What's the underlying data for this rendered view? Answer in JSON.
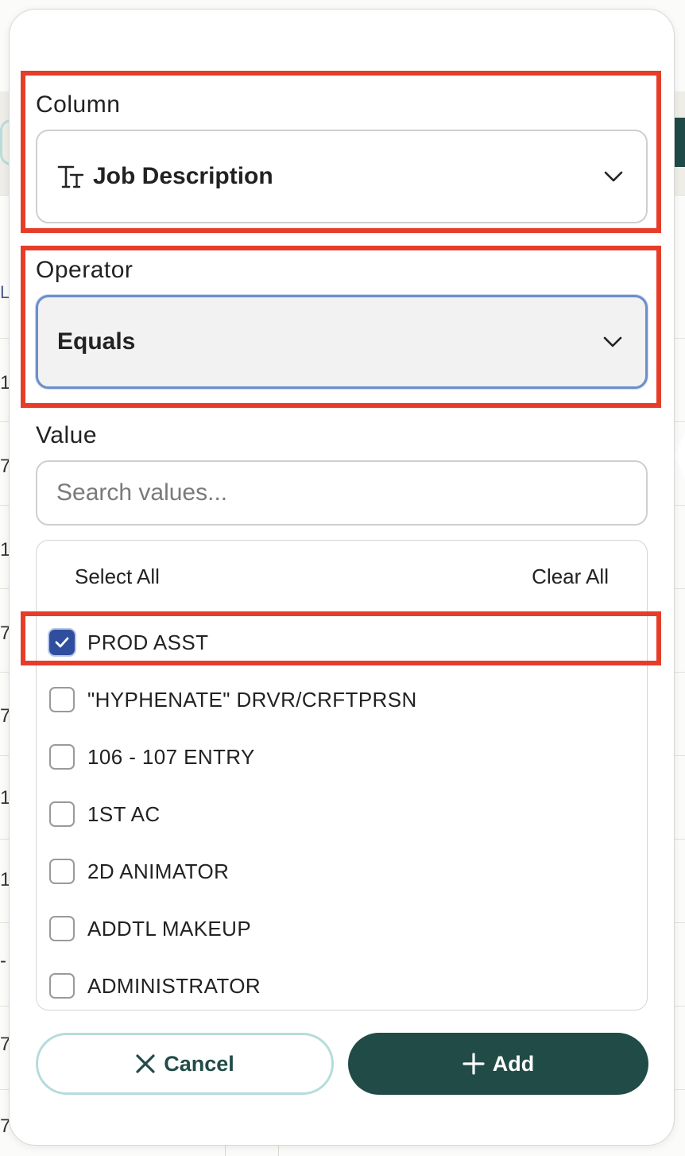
{
  "column": {
    "label": "Column",
    "value": "Job Description",
    "icon": "text-type-icon"
  },
  "operator": {
    "label": "Operator",
    "value": "Equals"
  },
  "value": {
    "label": "Value",
    "search_placeholder": "Search values...",
    "select_all": "Select All",
    "clear_all": "Clear All",
    "options": [
      {
        "label": "PROD ASST",
        "checked": true
      },
      {
        "label": "\"HYPHENATE\" DRVR/CRFTPRSN",
        "checked": false
      },
      {
        "label": "106 - 107 ENTRY",
        "checked": false
      },
      {
        "label": "1ST AC",
        "checked": false
      },
      {
        "label": "2D ANIMATOR",
        "checked": false
      },
      {
        "label": "ADDTL MAKEUP",
        "checked": false
      },
      {
        "label": "ADMINISTRATOR",
        "checked": false
      }
    ]
  },
  "buttons": {
    "cancel": "Cancel",
    "add": "Add"
  },
  "background_fragments": [
    "L",
    "1",
    "7",
    "1",
    "7",
    "7",
    "1",
    "1",
    "-",
    "7",
    "7"
  ],
  "colors": {
    "highlight": "#e63d2a",
    "primary": "#204b47",
    "checkbox": "#2f4f9e",
    "focus": "#6e8fc9"
  }
}
